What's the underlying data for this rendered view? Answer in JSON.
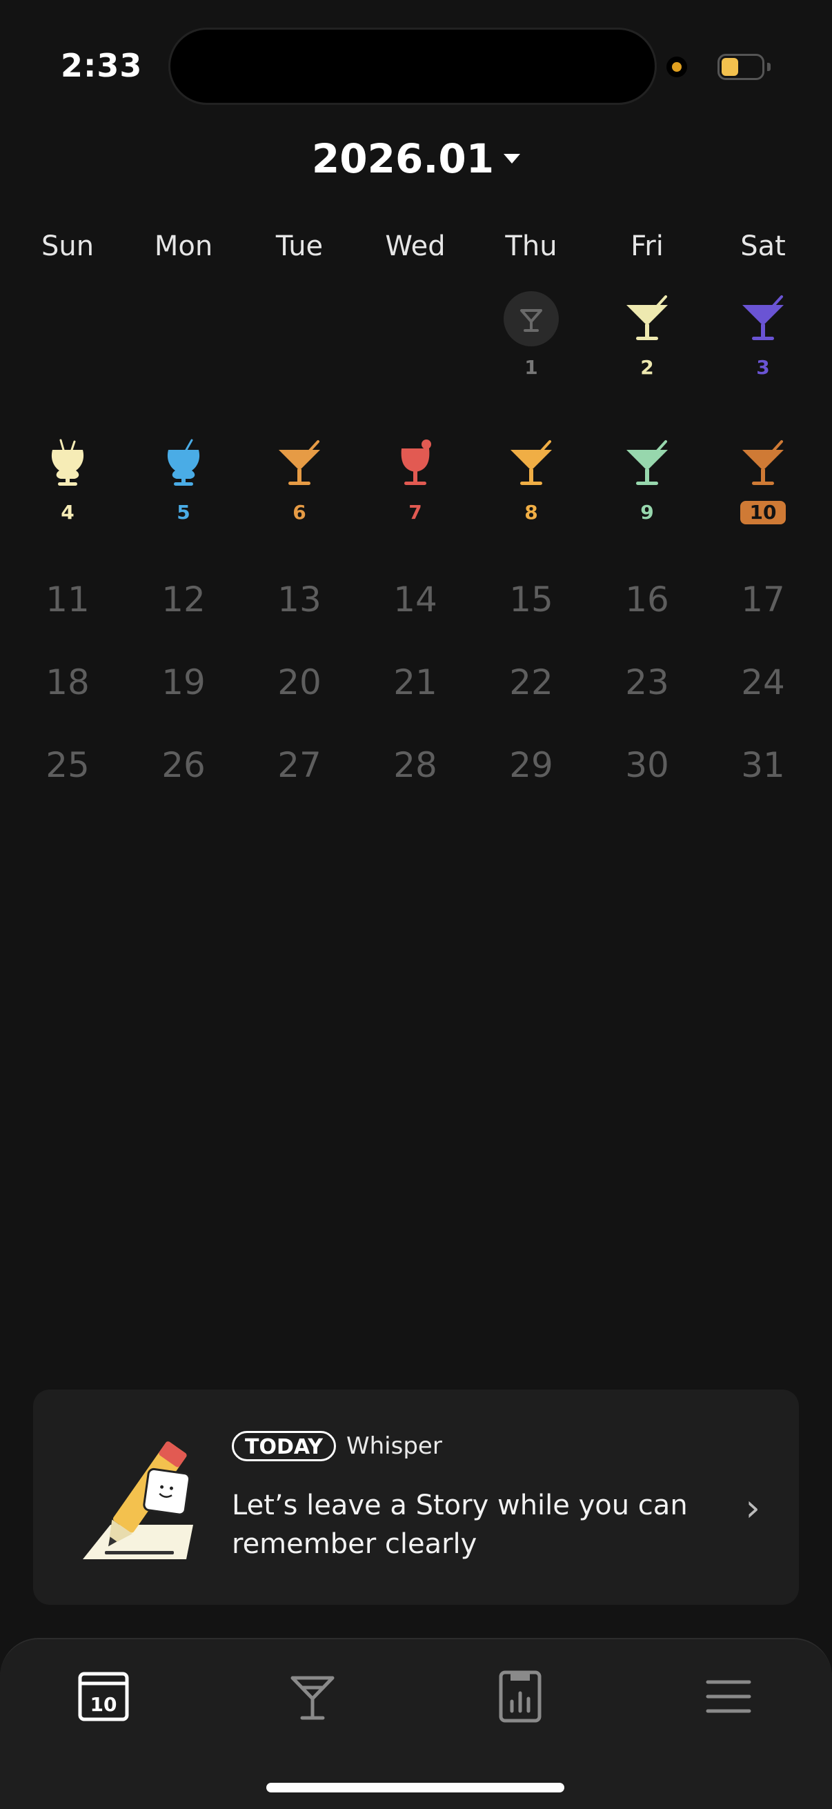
{
  "status_bar": {
    "time": "2:33",
    "battery_accent": "#f3c14e"
  },
  "calendar": {
    "month_label": "2026.01",
    "weekdays": [
      "Sun",
      "Mon",
      "Tue",
      "Wed",
      "Thu",
      "Fri",
      "Sat"
    ],
    "logged_days": [
      {
        "day": "1",
        "drink": "empty-glass-icon",
        "color": "#555555"
      },
      {
        "day": "2",
        "drink": "martini-glass-icon",
        "color": "#eee9b0"
      },
      {
        "day": "3",
        "drink": "martini-glass-icon",
        "color": "#6a54d4"
      },
      {
        "day": "4",
        "drink": "hurricane-glass-icon",
        "color": "#f6ecb6"
      },
      {
        "day": "5",
        "drink": "hurricane-glass-icon",
        "color": "#4aace6"
      },
      {
        "day": "6",
        "drink": "martini-glass-icon",
        "color": "#e69b45"
      },
      {
        "day": "7",
        "drink": "wine-glass-icon",
        "color": "#e25a52"
      },
      {
        "day": "8",
        "drink": "martini-glass-icon",
        "color": "#f0ae45"
      },
      {
        "day": "9",
        "drink": "martini-glass-icon",
        "color": "#97d7ad"
      },
      {
        "day": "10",
        "drink": "martini-glass-icon",
        "color": "#cf7a35",
        "today": true
      }
    ],
    "future_days": [
      "11",
      "12",
      "13",
      "14",
      "15",
      "16",
      "17",
      "18",
      "19",
      "20",
      "21",
      "22",
      "23",
      "24",
      "25",
      "26",
      "27",
      "28",
      "29",
      "30",
      "31"
    ]
  },
  "story_card": {
    "badge": "TODAY",
    "source": "Whisper",
    "text": "Let’s leave a Story while you can remember clearly"
  },
  "tabbar": {
    "calendar_day": "10",
    "tabs": [
      "calendar-icon",
      "cocktail-glass-icon",
      "stats-icon",
      "menu-icon"
    ]
  }
}
